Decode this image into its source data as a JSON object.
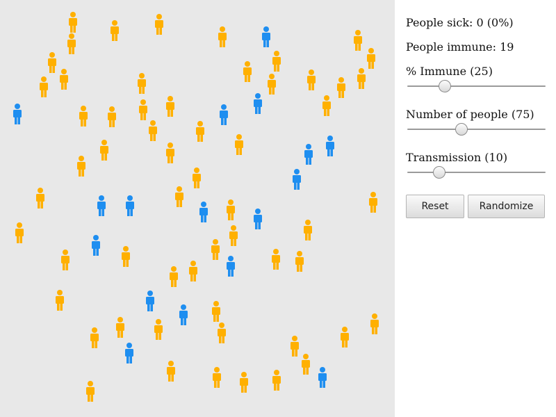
{
  "stats": {
    "sick_label": "People sick: 0 (0%)",
    "immune_label": "People immune: 19"
  },
  "sliders": [
    {
      "label": "% Immune (25)",
      "value": 25,
      "fraction": 0.27
    },
    {
      "label": "Number of people (75)",
      "value": 75,
      "fraction": 0.39
    },
    {
      "label": "Transmission (10)",
      "value": 10,
      "fraction": 0.23
    }
  ],
  "buttons": {
    "reset_label": "Reset",
    "randomize_label": "Randomize"
  },
  "colors": {
    "healthy": "#ffb000",
    "immune": "#1e8ef0",
    "canvas_bg": "#e8e8e8"
  },
  "people_status": [
    "healthy",
    "healthy",
    "healthy",
    "immune",
    "healthy",
    "healthy",
    "healthy",
    "healthy",
    "healthy",
    "healthy",
    "healthy",
    "healthy",
    "healthy",
    "healthy",
    "healthy",
    "healthy",
    "healthy",
    "healthy",
    "immune",
    "immune",
    "healthy",
    "healthy",
    "healthy",
    "healthy",
    "immune",
    "healthy",
    "healthy",
    "healthy",
    "healthy",
    "immune",
    "immune",
    "healthy",
    "healthy",
    "healthy",
    "healthy",
    "immune",
    "healthy",
    "immune",
    "immune",
    "healthy",
    "healthy",
    "immune",
    "healthy",
    "immune",
    "healthy",
    "healthy",
    "healthy",
    "immune",
    "healthy",
    "healthy",
    "healthy",
    "healthy",
    "healthy",
    "immune",
    "healthy",
    "healthy",
    "healthy",
    "immune",
    "immune",
    "healthy",
    "healthy",
    "healthy",
    "healthy",
    "healthy",
    "healthy",
    "healthy",
    "healthy",
    "immune",
    "healthy",
    "healthy",
    "healthy",
    "healthy",
    "healthy",
    "immune",
    "healthy"
  ]
}
